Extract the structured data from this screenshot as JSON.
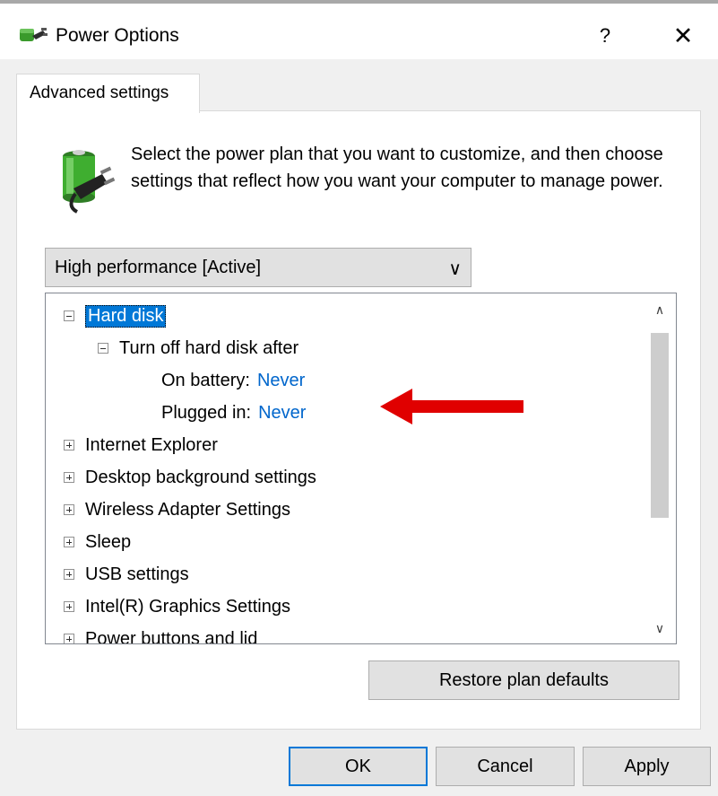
{
  "window": {
    "title": "Power Options",
    "help_label": "?",
    "close_label": "✕"
  },
  "tabs": [
    {
      "label": "Advanced settings",
      "active": true
    }
  ],
  "description": "Select the power plan that you want to customize, and then choose settings that reflect how you want your computer to manage power.",
  "plan_select": {
    "value": "High performance [Active]",
    "chevron": "∨"
  },
  "tree": {
    "nodes": [
      {
        "label": "Hard disk",
        "expander": "minus",
        "selected": true
      },
      {
        "label": "Turn off hard disk after",
        "expander": "minus"
      },
      {
        "label": "On battery:",
        "value": "Never"
      },
      {
        "label": "Plugged in:",
        "value": "Never"
      },
      {
        "label": "Internet Explorer",
        "expander": "plus"
      },
      {
        "label": "Desktop background settings",
        "expander": "plus"
      },
      {
        "label": "Wireless Adapter Settings",
        "expander": "plus"
      },
      {
        "label": "Sleep",
        "expander": "plus"
      },
      {
        "label": "USB settings",
        "expander": "plus"
      },
      {
        "label": "Intel(R) Graphics Settings",
        "expander": "plus"
      },
      {
        "label": "Power buttons and lid",
        "expander": "plus"
      }
    ],
    "scroll_up": "∧",
    "scroll_down": "∨"
  },
  "buttons": {
    "restore": "Restore plan defaults",
    "ok": "OK",
    "cancel": "Cancel",
    "apply": "Apply"
  },
  "colors": {
    "accent": "#0078d7",
    "link": "#0066cc",
    "annotation": "#e00000"
  },
  "icons": {
    "app": "power-options-icon",
    "plan": "battery-plug-icon",
    "annotation": "red-arrow-icon"
  }
}
